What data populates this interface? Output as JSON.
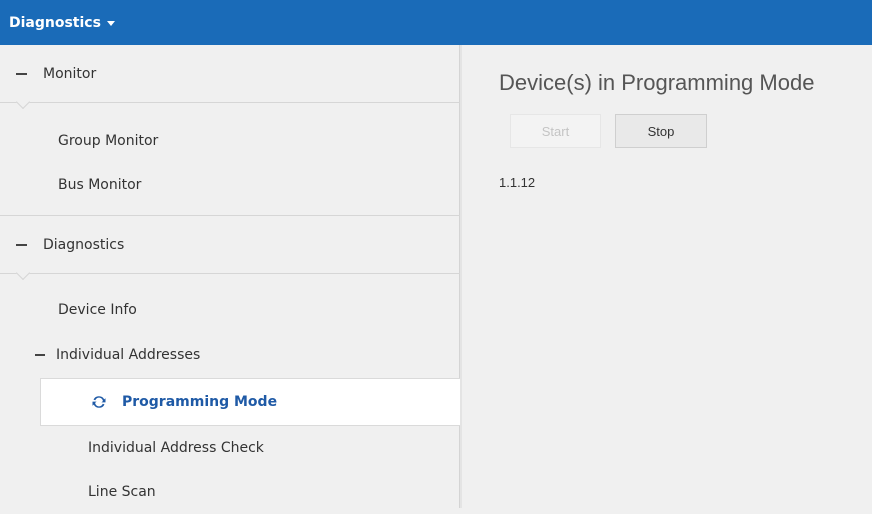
{
  "header": {
    "menu_title": "Diagnostics"
  },
  "sidebar": {
    "sections": [
      {
        "label": "Monitor",
        "items": [
          "Group Monitor",
          "Bus Monitor"
        ]
      },
      {
        "label": "Diagnostics",
        "items": [
          "Device Info"
        ],
        "subsection": {
          "label": "Individual Addresses",
          "items": [
            "Programming Mode",
            "Individual Address Check",
            "Line Scan"
          ],
          "selected": "Programming Mode"
        }
      }
    ]
  },
  "main": {
    "title": "Device(s) in Programming Mode",
    "start_label": "Start",
    "stop_label": "Stop",
    "start_enabled": false,
    "devices": [
      "1.1.12"
    ]
  },
  "colors": {
    "header_bg": "#1a6bb8",
    "selected_text": "#1f5aa6",
    "panel_bg": "#f0f0f0"
  },
  "icons": {
    "menu_dropdown": "caret-down-icon",
    "collapse": "minus-icon",
    "selected_item": "sync-icon"
  }
}
